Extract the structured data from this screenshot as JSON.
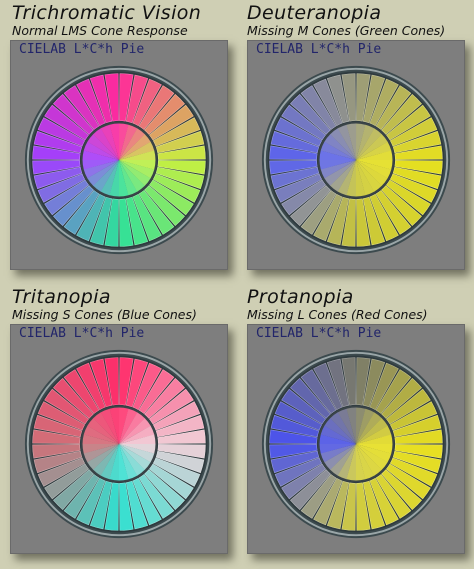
{
  "panels": [
    {
      "title": "Trichromatic Vision",
      "subtitle": "Normal LMS Cone Response",
      "label": "CIELAB L*C*h Pie",
      "colors": {
        "top": "#ff2a9a",
        "right": "#c8f040",
        "bottom": "#2ee09a",
        "left": "#a040ff"
      }
    },
    {
      "title": "Deuteranopia",
      "subtitle": "Missing M Cones (Green Cones)",
      "label": "CIELAB L*C*h Pie",
      "colors": {
        "top": "#9a9a7a",
        "right": "#e6e020",
        "bottom": "#c8c63a",
        "left": "#5a62f0"
      }
    },
    {
      "title": "Tritanopia",
      "subtitle": "Missing S Cones (Blue Cones)",
      "label": "CIELAB L*C*h Pie",
      "colors": {
        "top": "#ff2c6a",
        "right": "#f0d0d8",
        "bottom": "#30e0d0",
        "left": "#d07078"
      }
    },
    {
      "title": "Protanopia",
      "subtitle": "Missing L Cones (Red Cones)",
      "label": "CIELAB L*C*h Pie",
      "colors": {
        "top": "#7a7a6a",
        "right": "#e8e020",
        "bottom": "#d0cc40",
        "left": "#4a52f0"
      }
    }
  ]
}
